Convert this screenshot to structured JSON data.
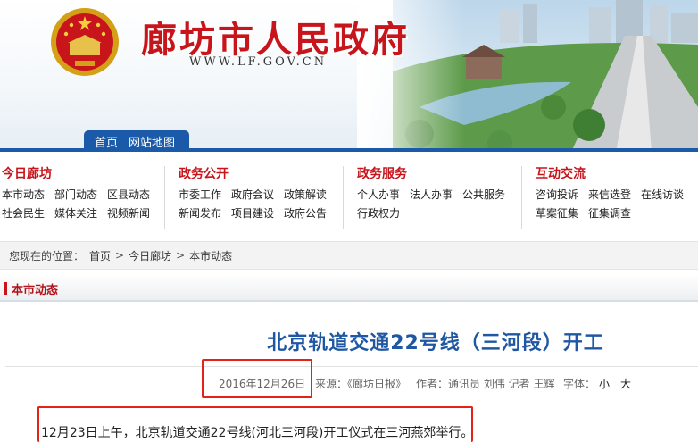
{
  "header": {
    "site_title": "廊坊市人民政府",
    "site_url": "WWW.LF.GOV.CN",
    "tabs": [
      "首页",
      "网站地图"
    ],
    "accent": "#c8141b",
    "blue": "#1a5aa8"
  },
  "nav": {
    "columns": [
      {
        "title": "今日廊坊",
        "rows": [
          [
            "本市动态",
            "部门动态",
            "区县动态"
          ],
          [
            "社会民生",
            "媒体关注",
            "视频新闻"
          ]
        ]
      },
      {
        "title": "政务公开",
        "rows": [
          [
            "市委工作",
            "政府会议",
            "政策解读"
          ],
          [
            "新闻发布",
            "项目建设",
            "政府公告"
          ]
        ]
      },
      {
        "title": "政务服务",
        "rows": [
          [
            "个人办事",
            "法人办事",
            "公共服务"
          ],
          [
            "行政权力"
          ]
        ]
      },
      {
        "title": "互动交流",
        "rows": [
          [
            "咨询投诉",
            "来信选登",
            "在线访谈"
          ],
          [
            "草案征集",
            "征集调查"
          ]
        ]
      }
    ]
  },
  "breadcrumb": {
    "prefix": "您现在的位置：",
    "items": [
      "首页",
      "今日廊坊",
      "本市动态"
    ],
    "separator": ">"
  },
  "section": {
    "label": "本市动态"
  },
  "article": {
    "title": "北京轨道交通22号线（三河段）开工",
    "date": "2016年12月26日",
    "source_label": "来源：",
    "source": "《廊坊日报》",
    "author_label": "作者：",
    "author": "通讯员 刘伟 记者 王辉",
    "font_label": "字体：",
    "font_small": "小",
    "font_large": "大",
    "body": "12月23日上午，北京轨道交通22号线(河北三河段)开工仪式在三河燕郊举行。",
    "highlight_color": "#e2231a"
  }
}
